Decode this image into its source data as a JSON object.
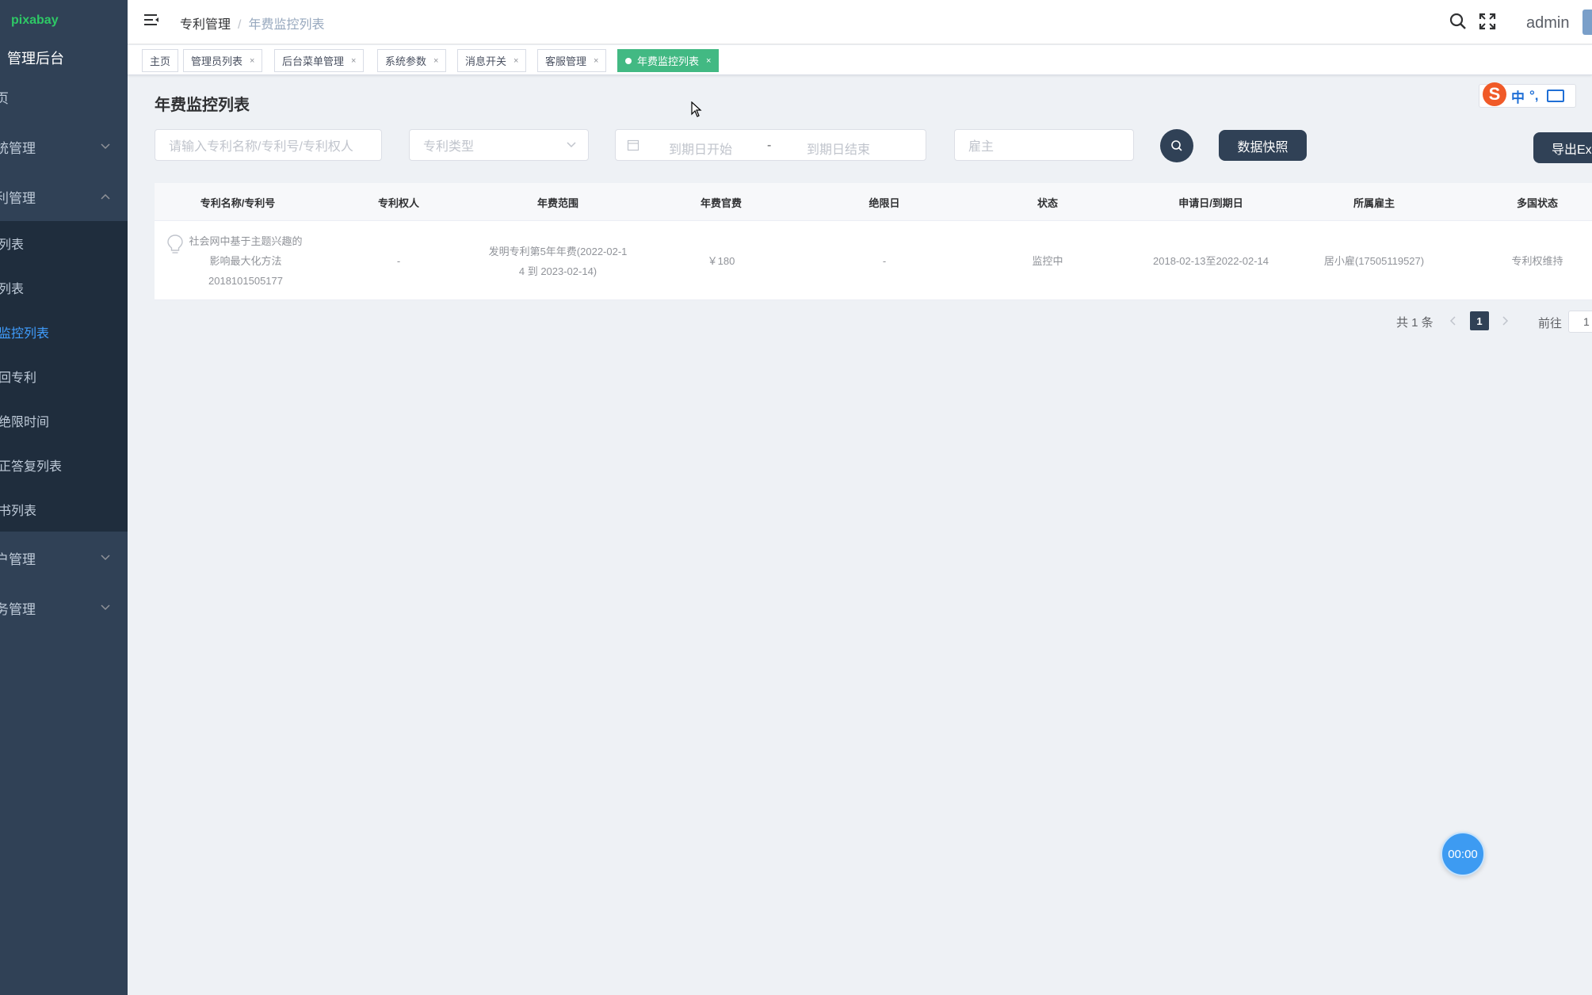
{
  "sidebar": {
    "logo": "pixabay",
    "app_title": "管理后台",
    "menu": [
      {
        "label": "页"
      },
      {
        "label": "统管理"
      },
      {
        "label": "利管理"
      },
      {
        "label": "户管理"
      },
      {
        "label": "务管理"
      }
    ],
    "submenu": [
      {
        "label": "列表"
      },
      {
        "label": "列表"
      },
      {
        "label": "监控列表"
      },
      {
        "label": "回专利"
      },
      {
        "label": "绝限时间"
      },
      {
        "label": "正答复列表"
      },
      {
        "label": "书列表"
      }
    ]
  },
  "header": {
    "breadcrumb": [
      "专利管理",
      "年费监控列表"
    ],
    "breadcrumb_sep": "/",
    "user": "admin"
  },
  "tags": [
    {
      "label": "主页",
      "closable": false
    },
    {
      "label": "管理员列表",
      "closable": true
    },
    {
      "label": "后台菜单管理",
      "closable": true
    },
    {
      "label": "系统参数",
      "closable": true
    },
    {
      "label": "消息开关",
      "closable": true
    },
    {
      "label": "客服管理",
      "closable": true
    },
    {
      "label": "年费监控列表",
      "closable": true,
      "active": true
    }
  ],
  "tag_close_glyph": "×",
  "page": {
    "title": "年费监控列表"
  },
  "ime": {
    "zh": "中",
    "punct": "°,"
  },
  "filters": {
    "keyword_placeholder": "请输入专利名称/专利号/专利权人",
    "type_placeholder": "专利类型",
    "date_start_placeholder": "到期日开始",
    "date_sep": "-",
    "date_end_placeholder": "到期日结束",
    "employer_placeholder": "雇主"
  },
  "buttons": {
    "snapshot": "数据快照",
    "export": "导出Excel"
  },
  "table": {
    "headers": [
      "专利名称/专利号",
      "专利权人",
      "年费范围",
      "年费官费",
      "绝限日",
      "状态",
      "申请日/到期日",
      "所属雇主",
      "多国状态"
    ],
    "rows": [
      {
        "name_line1": "社会网中基于主题兴趣的",
        "name_line2": "影响最大化方法",
        "patent_no": "2018101505177",
        "holder": "-",
        "fee_range_line1": "发明专利第5年年费(2022-02-1",
        "fee_range_line2": "4 到 2023-02-14)",
        "official_fee": "￥180",
        "deadline": "-",
        "status": "监控中",
        "dates": "2018-02-13至2022-02-14",
        "employer": "居小雇(17505119527)",
        "multi_status": "专利权维持"
      }
    ]
  },
  "pagination": {
    "total_text": "共 1 条",
    "current_page": "1",
    "goto_label": "前往",
    "goto_value": "1"
  },
  "timer": "00:00",
  "colors": {
    "sidebar": "#304156",
    "submenu": "#1f2d3d",
    "active_menu": "#409eff",
    "active_tag": "#42b983",
    "primary_button": "#304156",
    "timer": "#3d9bf2"
  }
}
